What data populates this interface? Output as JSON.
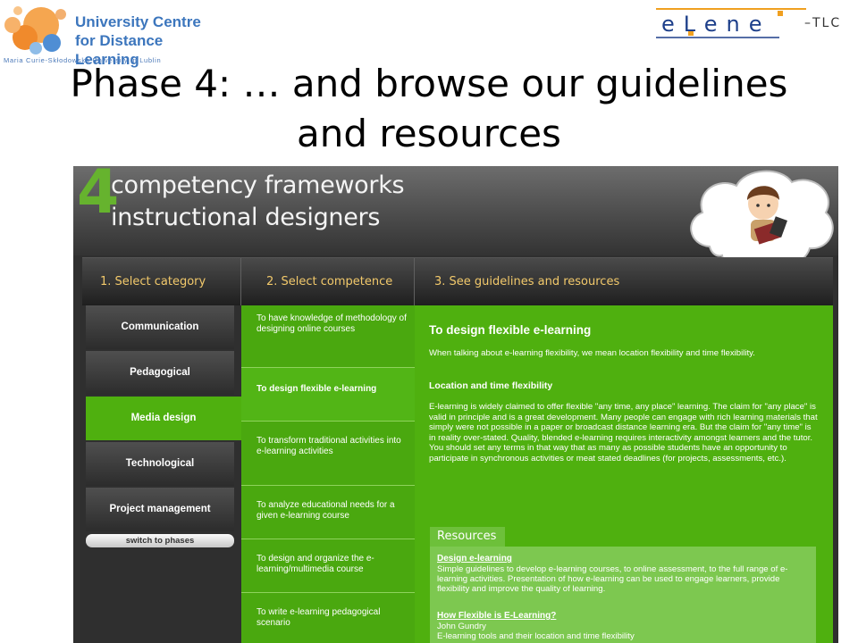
{
  "header": {
    "ucdl_line1": "University Centre",
    "ucdl_line2": "for Distance Learning",
    "ucdl_university": "Maria Curie-Skłodowska University in Lublin",
    "elene_word": "eLene",
    "elene_suffix": "–TLC",
    "slide_title_line1": "Phase 4: … and browse our guidelines",
    "slide_title_line2": "and resources"
  },
  "banner": {
    "number": "4",
    "line1": "competency frameworks",
    "line2": "instructional designers"
  },
  "columns": {
    "step1": "1. Select category",
    "step2": "2. Select competence",
    "step3": "3. See guidelines and resources"
  },
  "categories": [
    {
      "label": "Communication"
    },
    {
      "label": "Pedagogical"
    },
    {
      "label": "Media design"
    },
    {
      "label": "Technological"
    },
    {
      "label": "Project management"
    }
  ],
  "switch_button": "switch to phases",
  "competences": [
    {
      "label": "To have knowledge of methodology of designing online courses"
    },
    {
      "label": "To design flexible e-learning"
    },
    {
      "label": "To transform traditional activities into e-learning activities"
    },
    {
      "label": "To analyze educational needs for a given e-learning course"
    },
    {
      "label": "To design and organize the e-learning/multimedia course"
    },
    {
      "label": "To write e-learning pedagogical scenario"
    }
  ],
  "detail": {
    "title": "To design flexible e-learning",
    "intro": "When talking about e-learning flexibility, we mean location flexibility and time flexibility.",
    "subtitle": "Location and time flexibility",
    "body": "E-learning is widely claimed to offer flexible \"any time, any place\" learning. The claim for \"any place\" is valid in principle and is a great development. Many people can engage with rich learning materials that simply were not possible in a paper or broadcast distance learning era. But the claim for \"any time\" is in reality over-stated. Quality, blended e-learning requires interactivity amongst learners and the tutor. You should set any terms in that way that as many as possible students have an opportunity to participate in synchronous activities or meat stated deadlines (for projects, assessments, etc.).",
    "resources_tab": "Resources",
    "resources": [
      {
        "title": "Design e-learning",
        "description": "Simple guidelines to develop e-learning courses, to online assessment, to the full range of e-learning activities. Presentation of how e-learning can be used to engage learners, provide flexibility and improve the quality of learning."
      },
      {
        "title": "How Flexible is E-Learning?",
        "author": "John Gundry",
        "description": "E-learning tools and their location and time flexibility"
      }
    ]
  },
  "colors": {
    "accent_green": "#4fb00f",
    "heading_gold": "#f2c96b",
    "dark_panel": "#2f2f2f"
  }
}
